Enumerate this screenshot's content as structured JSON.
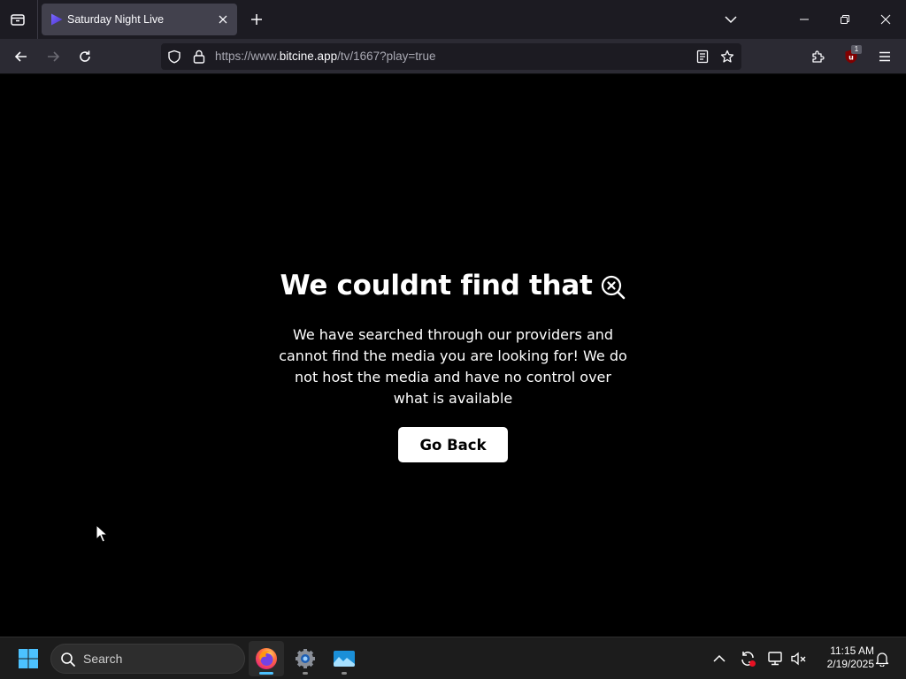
{
  "browser": {
    "tab": {
      "title": "Saturday Night Live"
    },
    "url": {
      "scheme": "https://www.",
      "host": "bitcine.app",
      "path": "/tv/1667?play=true"
    },
    "extension_badge": "1"
  },
  "page": {
    "heading": "We couldnt find that",
    "description": "We have searched through our providers and cannot find the media you are looking for! We do not host the media and have no control over what is available",
    "button_label": "Go Back"
  },
  "taskbar": {
    "search_label": "Search",
    "time": "11:15 AM",
    "date": "2/19/2025"
  },
  "colors": {
    "tab_bar": "#1c1b22",
    "nav_bar": "#2b2a33",
    "active_tab": "#42414d",
    "page_background": "#000000",
    "button_background": "#ffffff",
    "taskbar": "#1c1c1c",
    "firefox_indicator": "#4cc2ff"
  },
  "icons": {
    "tab_list": "tab-list-icon",
    "favicon": "play-triangle-favicon",
    "heading": "search-x-icon",
    "firefox": "firefox-icon",
    "settings": "settings-gear-icon",
    "photos": "photos-icon"
  }
}
